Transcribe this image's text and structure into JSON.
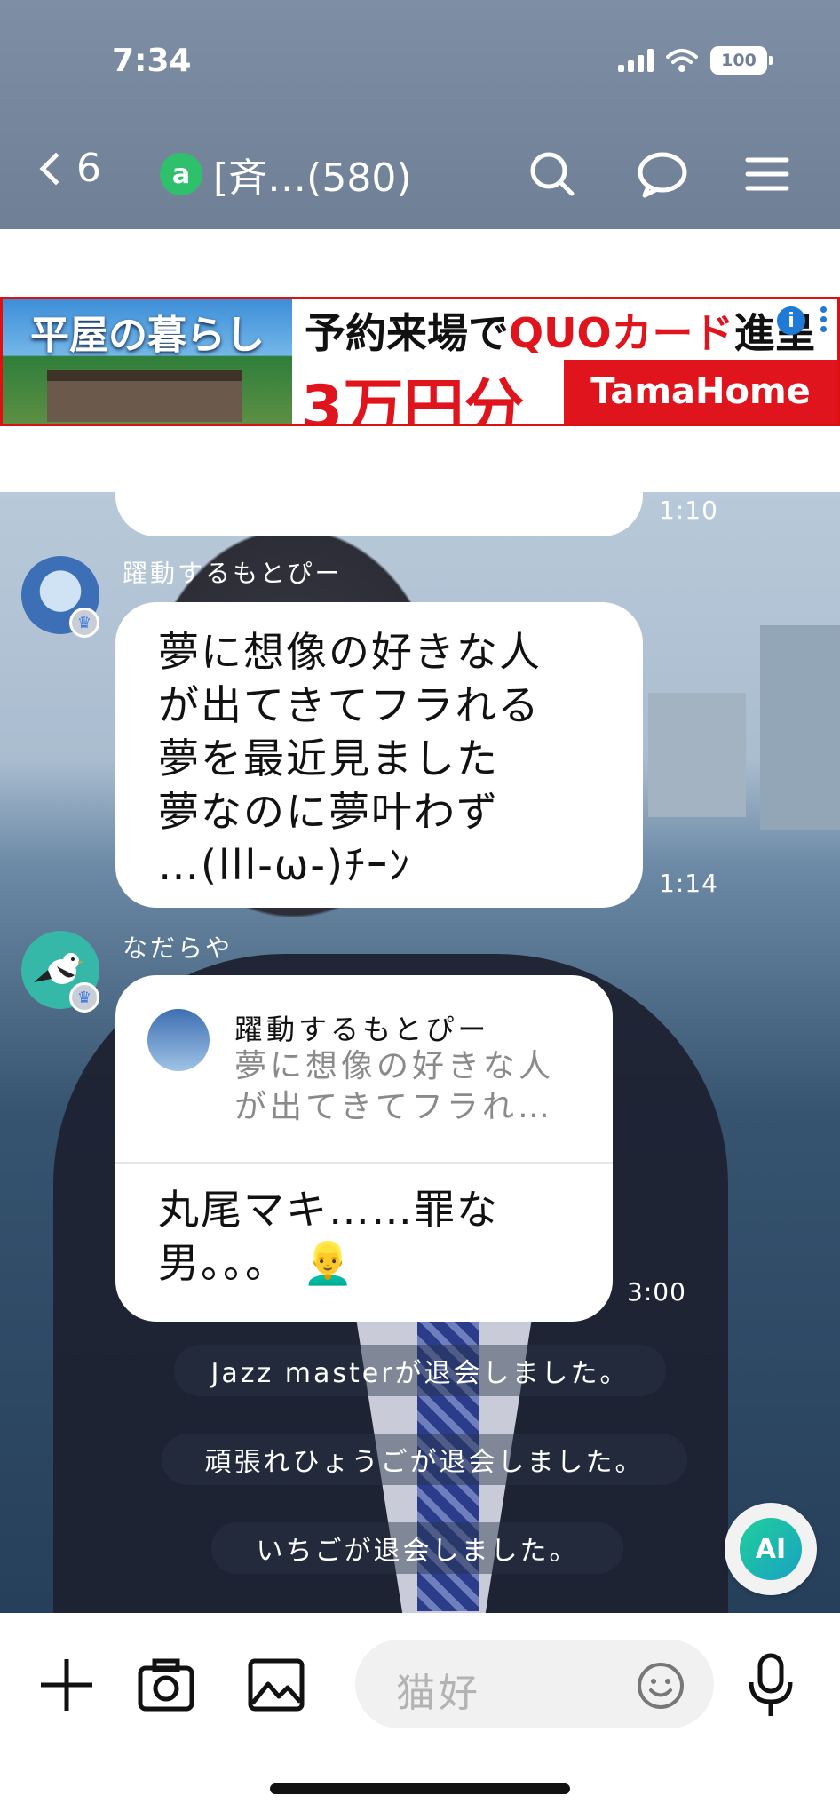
{
  "status_bar": {
    "time": "7:34",
    "battery": "100"
  },
  "header": {
    "back_count": "6",
    "open_badge": "a",
    "room_title": "[斉…(580)"
  },
  "ad": {
    "left_title": "平屋の暮らし",
    "line1_prefix": "予約来場で",
    "line1_red": "QUOカード",
    "line1_suffix": "進呈",
    "line2": "3万円分",
    "brand": "TamaHome",
    "info": "i"
  },
  "chat": {
    "partial_time": "1:10",
    "messages": [
      {
        "sender": "躍動するもとぴー",
        "text": "夢に想像の好きな人\nが出てきてフラれる\n夢を最近見ました\n夢なのに夢叶わず\n…(lll-ω-)ﾁｰﾝ",
        "time": "1:14"
      },
      {
        "sender": "なだらや",
        "reply_to_name": "躍動するもとぴー",
        "reply_to_text": "夢に想像の好きな人\nが出てきてフラれ…",
        "text": "丸尾マキ……罪な\n男。。。 👱‍♂️",
        "time": "3:00"
      }
    ],
    "system_messages": [
      "Jazz masterが退会しました。",
      "頑張れひょうごが退会しました。",
      "いちごが退会しました。"
    ],
    "ai_button": "AI"
  },
  "composer": {
    "input_value": "猫好"
  },
  "colors": {
    "header_bg": "#7e8ea4",
    "open_badge": "#2fc06b",
    "ad_red": "#e0141c",
    "ai_green": "#1fcf9a"
  }
}
